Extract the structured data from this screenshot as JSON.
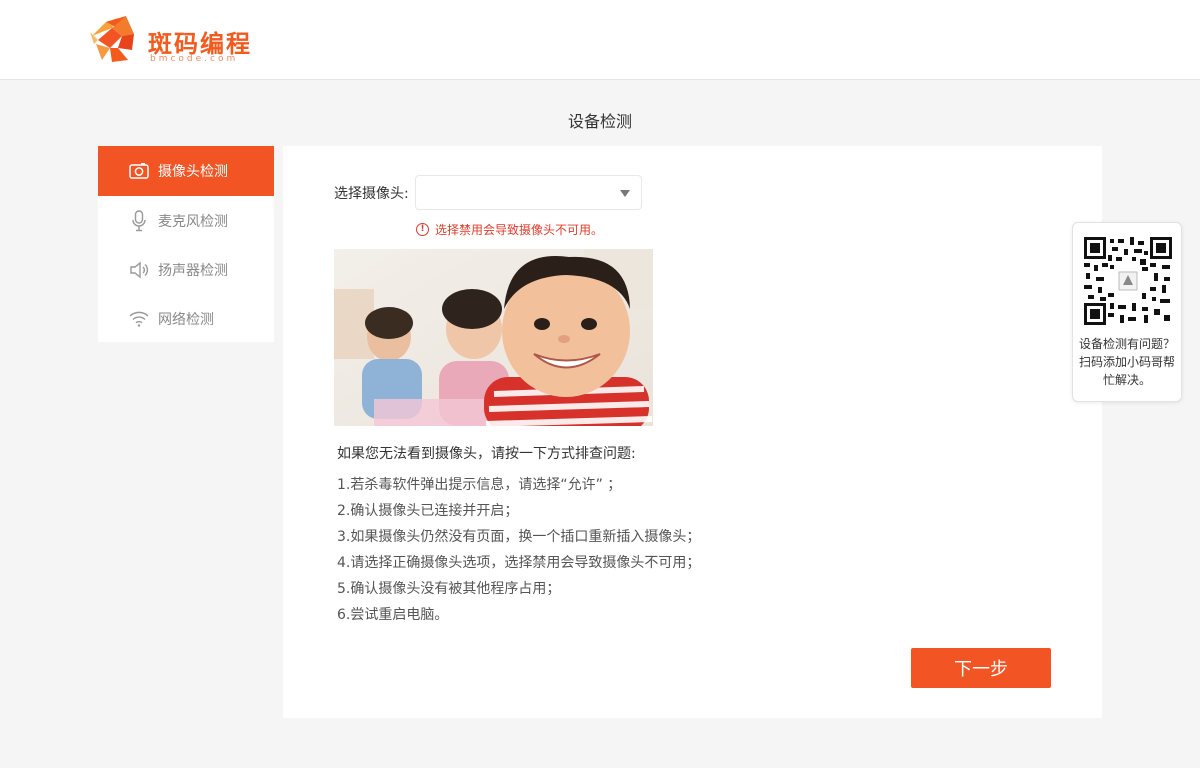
{
  "brand": {
    "name_cn": "斑码编程",
    "name_en": "bmcode.com",
    "accent": "#f25424"
  },
  "page": {
    "title": "设备检测"
  },
  "sidebar": {
    "items": [
      {
        "label": "摄像头检测",
        "icon": "camera-icon",
        "active": true
      },
      {
        "label": "麦克风检测",
        "icon": "microphone-icon",
        "active": false
      },
      {
        "label": "扬声器检测",
        "icon": "speaker-icon",
        "active": false
      },
      {
        "label": "网络检测",
        "icon": "wifi-icon",
        "active": false
      }
    ]
  },
  "camera": {
    "select_label": "选择摄像头:",
    "selected_value": "",
    "warning": "选择禁用会导致摄像头不可用。"
  },
  "tips": {
    "lead": "如果您无法看到摄像头，请按一下方式排查问题:",
    "items": [
      "1.若杀毒软件弹出提示信息，请选择“允许” ；",
      "2.确认摄像头已连接并开启；",
      "3.如果摄像头仍然没有页面，换一个插口重新插入摄像头；",
      "4.请选择正确摄像头选项，选择禁用会导致摄像头不可用；",
      "5.确认摄像头没有被其他程序占用；",
      "6.尝试重启电脑。"
    ]
  },
  "actions": {
    "next_label": "下一步"
  },
  "help": {
    "line1": "设备检测有问题？",
    "line2": "扫码添加小码哥帮",
    "line3": "忙解决。"
  }
}
